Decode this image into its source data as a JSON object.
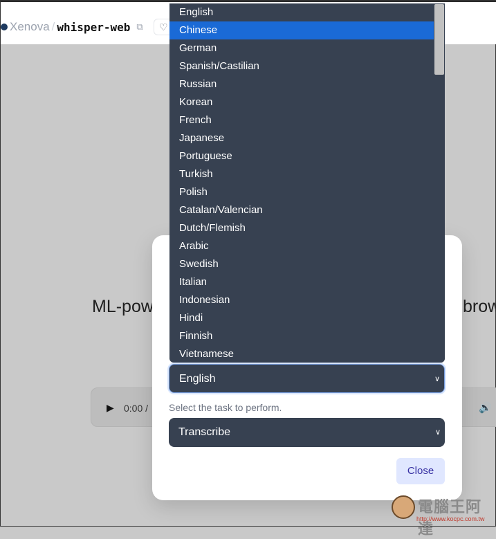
{
  "header": {
    "owner": "Xenova",
    "separator": "/",
    "repo": "whisper-web",
    "copy_icon": "copy-icon",
    "like_icon": "heart-icon"
  },
  "background": {
    "headline_left": "ML-pow",
    "headline_right": "brow",
    "player": {
      "play_icon": "play-icon",
      "time": "0:00 / ",
      "volume_icon": "volume-icon"
    }
  },
  "modal": {
    "language_select": {
      "value": "English"
    },
    "task_label": "Select the task to perform.",
    "task_select": {
      "value": "Transcribe"
    },
    "close_label": "Close"
  },
  "dropdown": {
    "highlighted": "Chinese",
    "options": [
      "English",
      "Chinese",
      "German",
      "Spanish/Castilian",
      "Russian",
      "Korean",
      "French",
      "Japanese",
      "Portuguese",
      "Turkish",
      "Polish",
      "Catalan/Valencian",
      "Dutch/Flemish",
      "Arabic",
      "Swedish",
      "Italian",
      "Indonesian",
      "Hindi",
      "Finnish",
      "Vietnamese"
    ],
    "scroll_position": 0.0
  },
  "watermark": {
    "name": "電腦王阿達",
    "url": "http://www.kocpc.com.tw"
  },
  "colors": {
    "select_bg": "#374151",
    "highlight": "#1a6ad6",
    "close_bg": "#e0e7ff",
    "close_text": "#3730a3"
  }
}
